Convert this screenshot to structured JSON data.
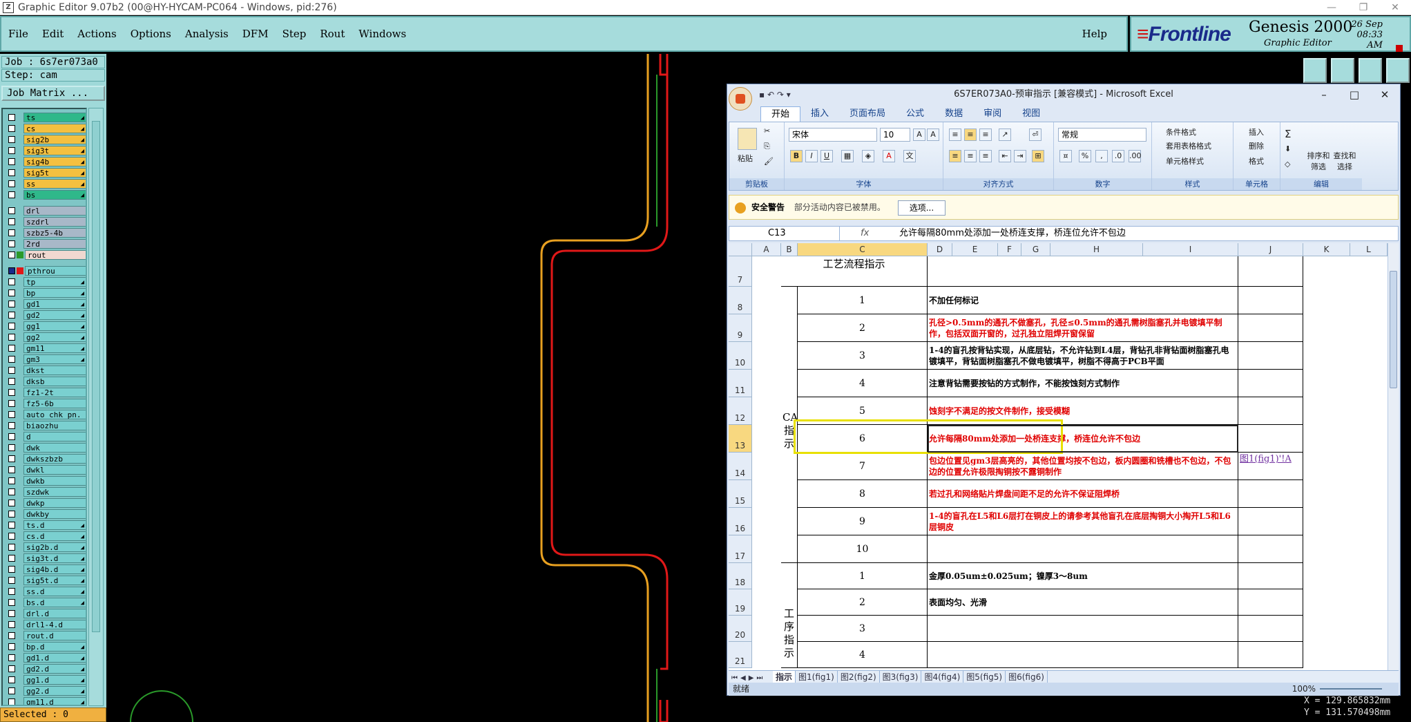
{
  "genesis": {
    "title": "Graphic Editor 9.07b2 (00@HY-HYCAM-PC064 - Windows, pid:276)",
    "menu": [
      "File",
      "Edit",
      "Actions",
      "Options",
      "Analysis",
      "DFM",
      "Step",
      "Rout",
      "Windows"
    ],
    "help": "Help",
    "brand": {
      "company": "Frontline",
      "product": "Genesis 2000",
      "subtitle": "Graphic Editor",
      "date": "26 Sep",
      "time": "08:33 AM"
    },
    "job_label": "Job : 6s7er073a0",
    "step_label": "Step: cam",
    "job_matrix": "Job Matrix ...",
    "selected": "Selected : 0",
    "coords": {
      "x": "X = 129.865832mm",
      "y": "Y = 131.570498mm"
    },
    "layers": [
      {
        "name": "ts",
        "color": "#2fb88a",
        "arrow": true
      },
      {
        "name": "cs",
        "color": "#f4c040",
        "arrow": true
      },
      {
        "name": "sig2b",
        "color": "#f4c040",
        "arrow": true
      },
      {
        "name": "sig3t",
        "color": "#f4c040",
        "arrow": true
      },
      {
        "name": "sig4b",
        "color": "#f4c040",
        "arrow": true
      },
      {
        "name": "sig5t",
        "color": "#f4c040",
        "arrow": true
      },
      {
        "name": "ss",
        "color": "#f4c040",
        "arrow": true
      },
      {
        "name": "bs",
        "color": "#2fb88a",
        "arrow": true
      },
      {
        "name": "drl",
        "color": "#a8b8c8",
        "gap": true
      },
      {
        "name": "szdrl",
        "color": "#a8b8c8"
      },
      {
        "name": "szbz5-4b",
        "color": "#a8b8c8"
      },
      {
        "name": "2rd",
        "color": "#a8b8c8"
      },
      {
        "name": "rout",
        "color": "#f0d8d0",
        "swatch": "#2a9a2a"
      },
      {
        "name": "pthrou",
        "color": "#7ad0d0",
        "gap": true,
        "swatch": "#e01818",
        "dark": true
      },
      {
        "name": "tp",
        "color": "#7ad0d0",
        "arrow": true
      },
      {
        "name": "bp",
        "color": "#7ad0d0",
        "arrow": true
      },
      {
        "name": "gd1",
        "color": "#7ad0d0",
        "arrow": true
      },
      {
        "name": "gd2",
        "color": "#7ad0d0",
        "arrow": true
      },
      {
        "name": "gg1",
        "color": "#7ad0d0",
        "arrow": true
      },
      {
        "name": "gg2",
        "color": "#7ad0d0",
        "arrow": true
      },
      {
        "name": "gm11",
        "color": "#7ad0d0",
        "arrow": true
      },
      {
        "name": "gm3",
        "color": "#7ad0d0",
        "arrow": true
      },
      {
        "name": "dkst",
        "color": "#7ad0d0"
      },
      {
        "name": "dksb",
        "color": "#7ad0d0"
      },
      {
        "name": "fz1-2t",
        "color": "#7ad0d0"
      },
      {
        "name": "fz5-6b",
        "color": "#7ad0d0"
      },
      {
        "name": "auto_chk_pn.",
        "color": "#7ad0d0"
      },
      {
        "name": "biaozhu",
        "color": "#7ad0d0"
      },
      {
        "name": "d",
        "color": "#7ad0d0"
      },
      {
        "name": "dwk",
        "color": "#7ad0d0"
      },
      {
        "name": "dwkszbzb",
        "color": "#7ad0d0"
      },
      {
        "name": "dwkl",
        "color": "#7ad0d0"
      },
      {
        "name": "dwkb",
        "color": "#7ad0d0"
      },
      {
        "name": "szdwk",
        "color": "#7ad0d0"
      },
      {
        "name": "dwkp",
        "color": "#7ad0d0"
      },
      {
        "name": "dwkby",
        "color": "#7ad0d0"
      },
      {
        "name": "ts.d",
        "color": "#7ad0d0",
        "arrow": true
      },
      {
        "name": "cs.d",
        "color": "#7ad0d0",
        "arrow": true
      },
      {
        "name": "sig2b.d",
        "color": "#7ad0d0",
        "arrow": true
      },
      {
        "name": "sig3t.d",
        "color": "#7ad0d0",
        "arrow": true
      },
      {
        "name": "sig4b.d",
        "color": "#7ad0d0",
        "arrow": true
      },
      {
        "name": "sig5t.d",
        "color": "#7ad0d0",
        "arrow": true
      },
      {
        "name": "ss.d",
        "color": "#7ad0d0",
        "arrow": true
      },
      {
        "name": "bs.d",
        "color": "#7ad0d0",
        "arrow": true
      },
      {
        "name": "drl.d",
        "color": "#7ad0d0"
      },
      {
        "name": "drl1-4.d",
        "color": "#7ad0d0"
      },
      {
        "name": "rout.d",
        "color": "#7ad0d0"
      },
      {
        "name": "bp.d",
        "color": "#7ad0d0",
        "arrow": true
      },
      {
        "name": "gd1.d",
        "color": "#7ad0d0",
        "arrow": true
      },
      {
        "name": "gd2.d",
        "color": "#7ad0d0",
        "arrow": true
      },
      {
        "name": "gg1.d",
        "color": "#7ad0d0",
        "arrow": true
      },
      {
        "name": "gg2.d",
        "color": "#7ad0d0",
        "arrow": true
      },
      {
        "name": "gm11.d",
        "color": "#7ad0d0",
        "arrow": true
      }
    ]
  },
  "excel": {
    "title": "6S7ER073A0-预审指示 [兼容模式] - Microsoft Excel",
    "tabs": [
      "开始",
      "插入",
      "页面布局",
      "公式",
      "数据",
      "审阅",
      "视图"
    ],
    "ribbon": {
      "groups": [
        "剪贴板",
        "字体",
        "对齐方式",
        "数字",
        "样式",
        "单元格",
        "编辑"
      ],
      "paste": "粘贴",
      "font_name": "宋体",
      "font_size": "10",
      "number_format": "常规",
      "styles": [
        "条件格式",
        "套用表格格式",
        "单元格样式"
      ],
      "cells": [
        "插入",
        "删除",
        "格式"
      ],
      "edit": [
        "排序和筛选",
        "查找和选择"
      ]
    },
    "security": {
      "title": "安全警告",
      "message": "部分活动内容已被禁用。",
      "button": "选项..."
    },
    "name_box": "C13",
    "fx": "fx",
    "formula": "允许每隔80mm处添加一处桥连支撑，桥连位允许不包边",
    "columns": [
      "A",
      "B",
      "C",
      "D",
      "E",
      "F",
      "G",
      "H",
      "I",
      "J",
      "K",
      "L"
    ],
    "rows": [
      {
        "n": "7",
        "text": "",
        "c": ""
      },
      {
        "n": "8",
        "b": "1",
        "text": "不加任何标记",
        "c": "blk"
      },
      {
        "n": "9",
        "b": "2",
        "text": "孔径>0.5mm的通孔不做塞孔，孔径≤0.5mm的通孔需树脂塞孔并电镀填平制作，包括双面开窗的，过孔独立阻焊开窗保留",
        "c": "red"
      },
      {
        "n": "10",
        "b": "3",
        "text": "1-4的盲孔按背钻实现，从底层钻，不允许钻到L4层，背钻孔非背钻面树脂塞孔电镀填平，背钻面树脂塞孔不做电镀填平，树脂不得高于PCB平面",
        "c": "blk"
      },
      {
        "n": "11",
        "b": "4",
        "text": "注意背钻需要按钻的方式制作，不能按蚀刻方式制作",
        "c": "blk"
      },
      {
        "n": "12",
        "b": "5",
        "text": "蚀刻字不满足的按文件制作，接受模糊",
        "c": "red"
      },
      {
        "n": "13",
        "b": "6",
        "text": "允许每隔80mm处添加一处桥连支撑，桥连位允许不包边",
        "c": "red"
      },
      {
        "n": "14",
        "b": "7",
        "text": "包边位置见gm3层高亮的，其他位置均按不包边，板内圆圈和铣槽也不包边，不包边的位置允许极限掏铜按不露铜制作",
        "c": "red",
        "link": "图1(fig1)'!A"
      },
      {
        "n": "15",
        "b": "8",
        "text": "若过孔和网络贴片焊盘间距不足的允许不保证阻焊桥",
        "c": "red"
      },
      {
        "n": "16",
        "b": "9",
        "text": "1-4的盲孔在L5和L6层打在铜皮上的请参考其他盲孔在底层掏铜大小掏开L5和L6层铜皮",
        "c": "red"
      },
      {
        "n": "17",
        "b": "10",
        "text": "",
        "c": ""
      },
      {
        "n": "18",
        "b": "1",
        "text": "金厚0.05um±0.025um；镍厚3～8um",
        "c": "blk"
      },
      {
        "n": "19",
        "b": "2",
        "text": "表面均匀、光滑",
        "c": "blk"
      },
      {
        "n": "20",
        "b": "3",
        "text": "",
        "c": ""
      },
      {
        "n": "21",
        "b": "4",
        "text": "",
        "c": ""
      }
    ],
    "merged": {
      "r7": "工艺流程指示",
      "cam": "CAM指示",
      "proc": "工序指示"
    },
    "sheets": [
      "指示",
      "图1(fig1)",
      "图2(fig2)",
      "图3(fig3)",
      "图4(fig4)",
      "图5(fig5)",
      "图6(fig6)"
    ],
    "status": "就绪",
    "zoom": "100%"
  }
}
